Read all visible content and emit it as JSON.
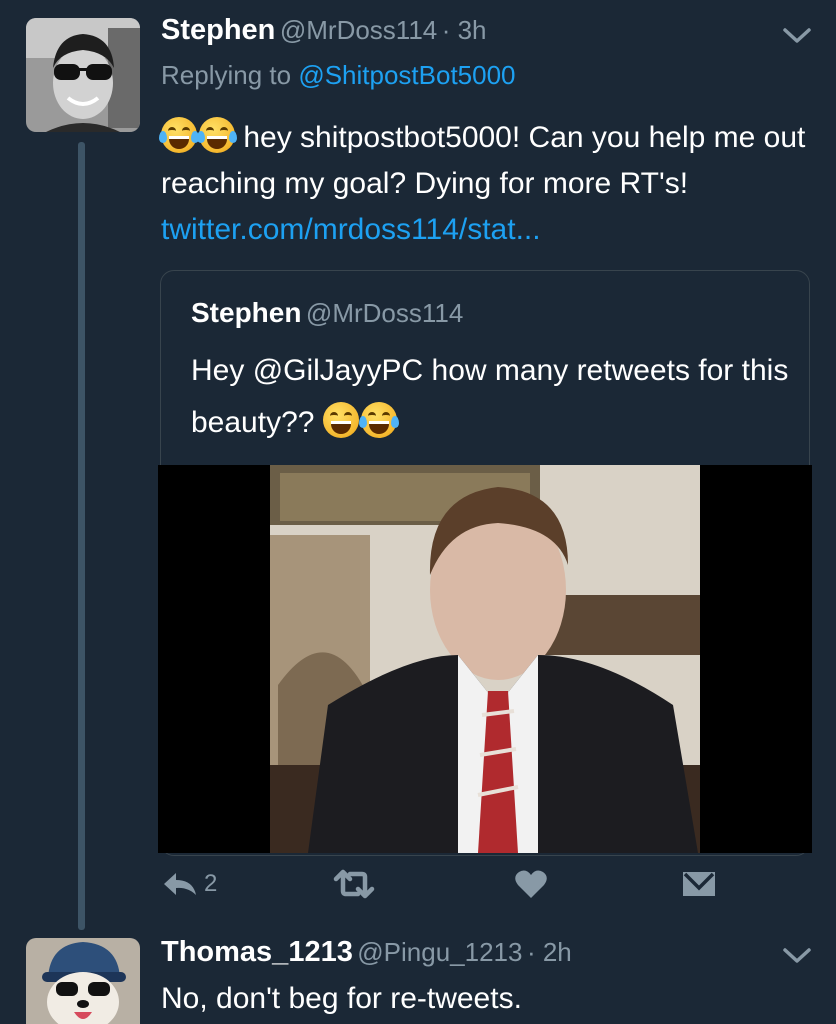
{
  "tweet1": {
    "name": "Stephen",
    "handle": "@MrDoss114",
    "time": "· 3h",
    "replying_prefix": "Replying to ",
    "replying_to": "@ShitpostBot5000",
    "text_part1": " hey shitpostbot5000!  Can you help me out reaching my goal? Dying for more RT's! ",
    "link": "twitter.com/mrdoss114/stat...",
    "reply_count": "2"
  },
  "quoted": {
    "name": "Stephen",
    "handle": "@MrDoss114",
    "text_prefix": "Hey ",
    "mention": "@GilJayyPC",
    "text_suffix": " how many retweets for this beauty?? "
  },
  "tweet2": {
    "name": "Thomas_1213",
    "handle": "@Pingu_1213",
    "time": "· 2h",
    "text": "No, don't beg for re-tweets."
  },
  "icons": {
    "reply": "reply-icon",
    "retweet": "retweet-icon",
    "like": "heart-icon",
    "dm": "envelope-icon",
    "more": "chevron-down-icon"
  },
  "colors": {
    "background": "#1b2836",
    "link": "#1da1f2",
    "muted": "#8899a6",
    "icon": "#8899a6"
  }
}
